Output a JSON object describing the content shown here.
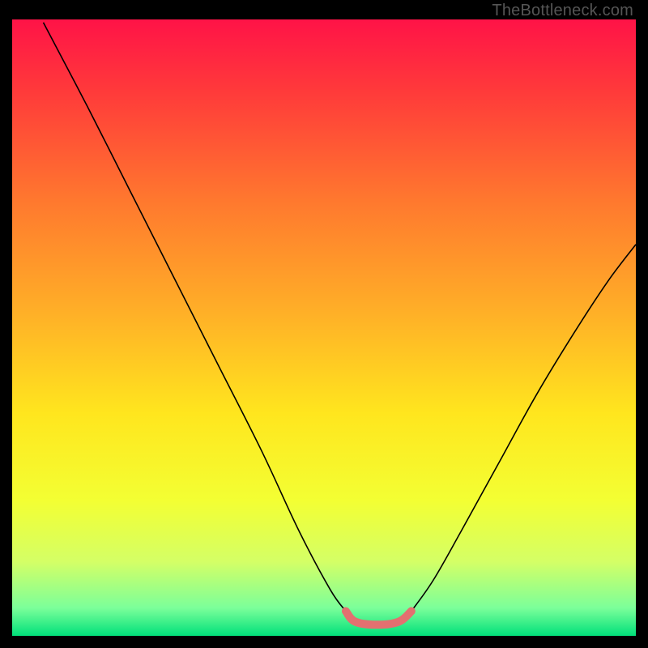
{
  "watermark": "TheBottleneck.com",
  "chart_data": {
    "type": "line",
    "title": "",
    "xlabel": "",
    "ylabel": "",
    "xlim": [
      0,
      100
    ],
    "ylim": [
      0,
      100
    ],
    "grid": false,
    "legend": false,
    "background_gradient": {
      "stops": [
        {
          "offset": 0.0,
          "color": "#ff1347"
        },
        {
          "offset": 0.12,
          "color": "#ff3b3a"
        },
        {
          "offset": 0.3,
          "color": "#ff7a2e"
        },
        {
          "offset": 0.48,
          "color": "#ffb127"
        },
        {
          "offset": 0.64,
          "color": "#ffe61e"
        },
        {
          "offset": 0.78,
          "color": "#f3ff33"
        },
        {
          "offset": 0.88,
          "color": "#d4ff66"
        },
        {
          "offset": 0.955,
          "color": "#7bff9a"
        },
        {
          "offset": 1.0,
          "color": "#00e07a"
        }
      ]
    },
    "series": [
      {
        "name": "left-branch",
        "stroke": "#000000",
        "stroke_width": 1.6,
        "points": [
          {
            "x": 5.0,
            "y": 99.5
          },
          {
            "x": 12.0,
            "y": 86.0
          },
          {
            "x": 19.0,
            "y": 72.0
          },
          {
            "x": 26.0,
            "y": 58.0
          },
          {
            "x": 33.0,
            "y": 44.0
          },
          {
            "x": 40.0,
            "y": 30.0
          },
          {
            "x": 46.0,
            "y": 17.0
          },
          {
            "x": 51.0,
            "y": 7.5
          },
          {
            "x": 53.5,
            "y": 4.0
          }
        ]
      },
      {
        "name": "right-branch",
        "stroke": "#000000",
        "stroke_width": 1.6,
        "points": [
          {
            "x": 64.0,
            "y": 4.0
          },
          {
            "x": 67.5,
            "y": 9.0
          },
          {
            "x": 72.0,
            "y": 17.0
          },
          {
            "x": 78.0,
            "y": 28.0
          },
          {
            "x": 84.0,
            "y": 39.0
          },
          {
            "x": 90.0,
            "y": 49.0
          },
          {
            "x": 95.5,
            "y": 57.5
          },
          {
            "x": 100.0,
            "y": 63.5
          }
        ]
      },
      {
        "name": "valley-base",
        "stroke": "#e37070",
        "stroke_width": 10,
        "linecap": "round",
        "points": [
          {
            "x": 53.5,
            "y": 4.0
          },
          {
            "x": 55.0,
            "y": 2.3
          },
          {
            "x": 58.5,
            "y": 1.8
          },
          {
            "x": 62.0,
            "y": 2.3
          },
          {
            "x": 64.0,
            "y": 4.0
          }
        ]
      }
    ]
  }
}
